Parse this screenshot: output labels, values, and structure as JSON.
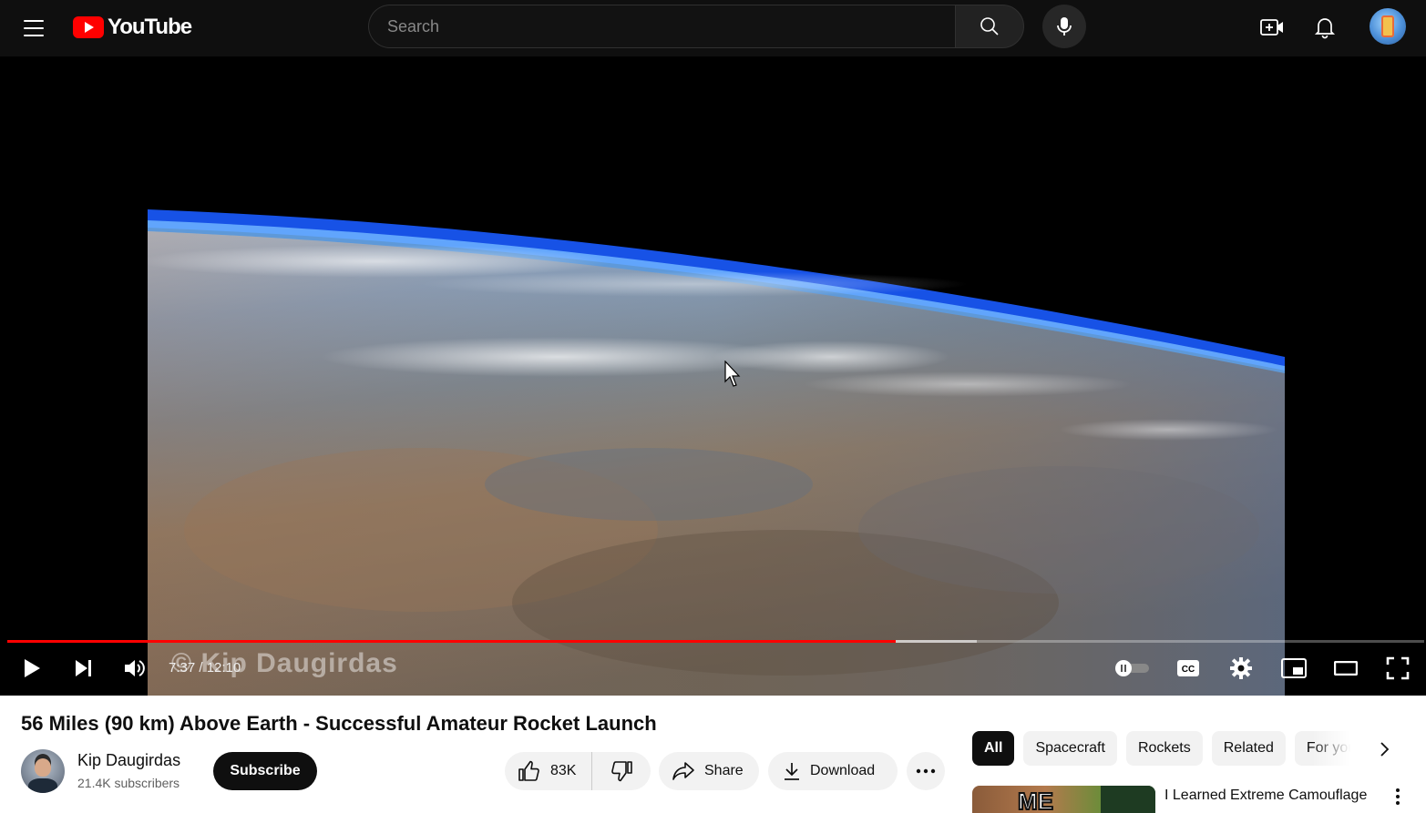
{
  "header": {
    "logo_text": "YouTube",
    "search_placeholder": "Search"
  },
  "player": {
    "current_time": "7:37",
    "duration": "12:10",
    "time_display": "7:37 / 12:10",
    "played_fraction": 0.627,
    "buffered_fraction": 0.684,
    "watermark": "© Kip Daugirdas"
  },
  "video": {
    "title": "56 Miles (90 km) Above Earth - Successful Amateur Rocket Launch",
    "channel_name": "Kip Daugirdas",
    "subscribers": "21.4K subscribers",
    "subscribe_label": "Subscribe",
    "like_count": "83K",
    "share_label": "Share",
    "download_label": "Download"
  },
  "chips": [
    "All",
    "Spacecraft",
    "Rockets",
    "Related",
    "For you"
  ],
  "recommendation": {
    "title": "I Learned Extreme Camouflage",
    "thumb_text": "ME"
  },
  "colors": {
    "progress_played": "#ff0000",
    "brand_red": "#ff0000",
    "topbar_bg": "#0f0f0f"
  }
}
